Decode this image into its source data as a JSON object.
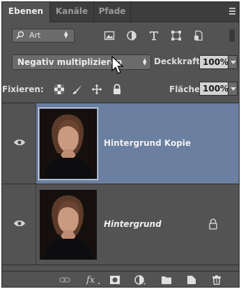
{
  "tabs": [
    {
      "label": "Ebenen",
      "active": true
    },
    {
      "label": "Kanäle",
      "active": false
    },
    {
      "label": "Pfade",
      "active": false
    }
  ],
  "filter": {
    "kind_label": "Art",
    "icons": [
      "image-filter-icon",
      "adjustment-filter-icon",
      "type-filter-icon",
      "shape-filter-icon",
      "smart-object-filter-icon"
    ]
  },
  "blend": {
    "mode": "Negativ multiplizieren",
    "opacity_label": "Deckkraft:",
    "opacity_value": "100%"
  },
  "lock": {
    "label": "Fixieren:",
    "fill_label": "Fläche:",
    "fill_value": "100%"
  },
  "layers": [
    {
      "name": "Hintergrund Kopie",
      "selected": true,
      "visible": true,
      "italic": false,
      "locked": false
    },
    {
      "name": "Hintergrund",
      "selected": false,
      "visible": true,
      "italic": true,
      "locked": true
    }
  ],
  "bottom_bar": [
    "link-layers-icon",
    "fx-icon",
    "add-mask-icon",
    "adjustment-layer-icon",
    "new-group-icon",
    "new-layer-icon",
    "delete-icon"
  ],
  "colors": {
    "panel_bg": "#535353",
    "selected_layer": "#6b7fa0",
    "field_bg": "#d2d2d2"
  }
}
